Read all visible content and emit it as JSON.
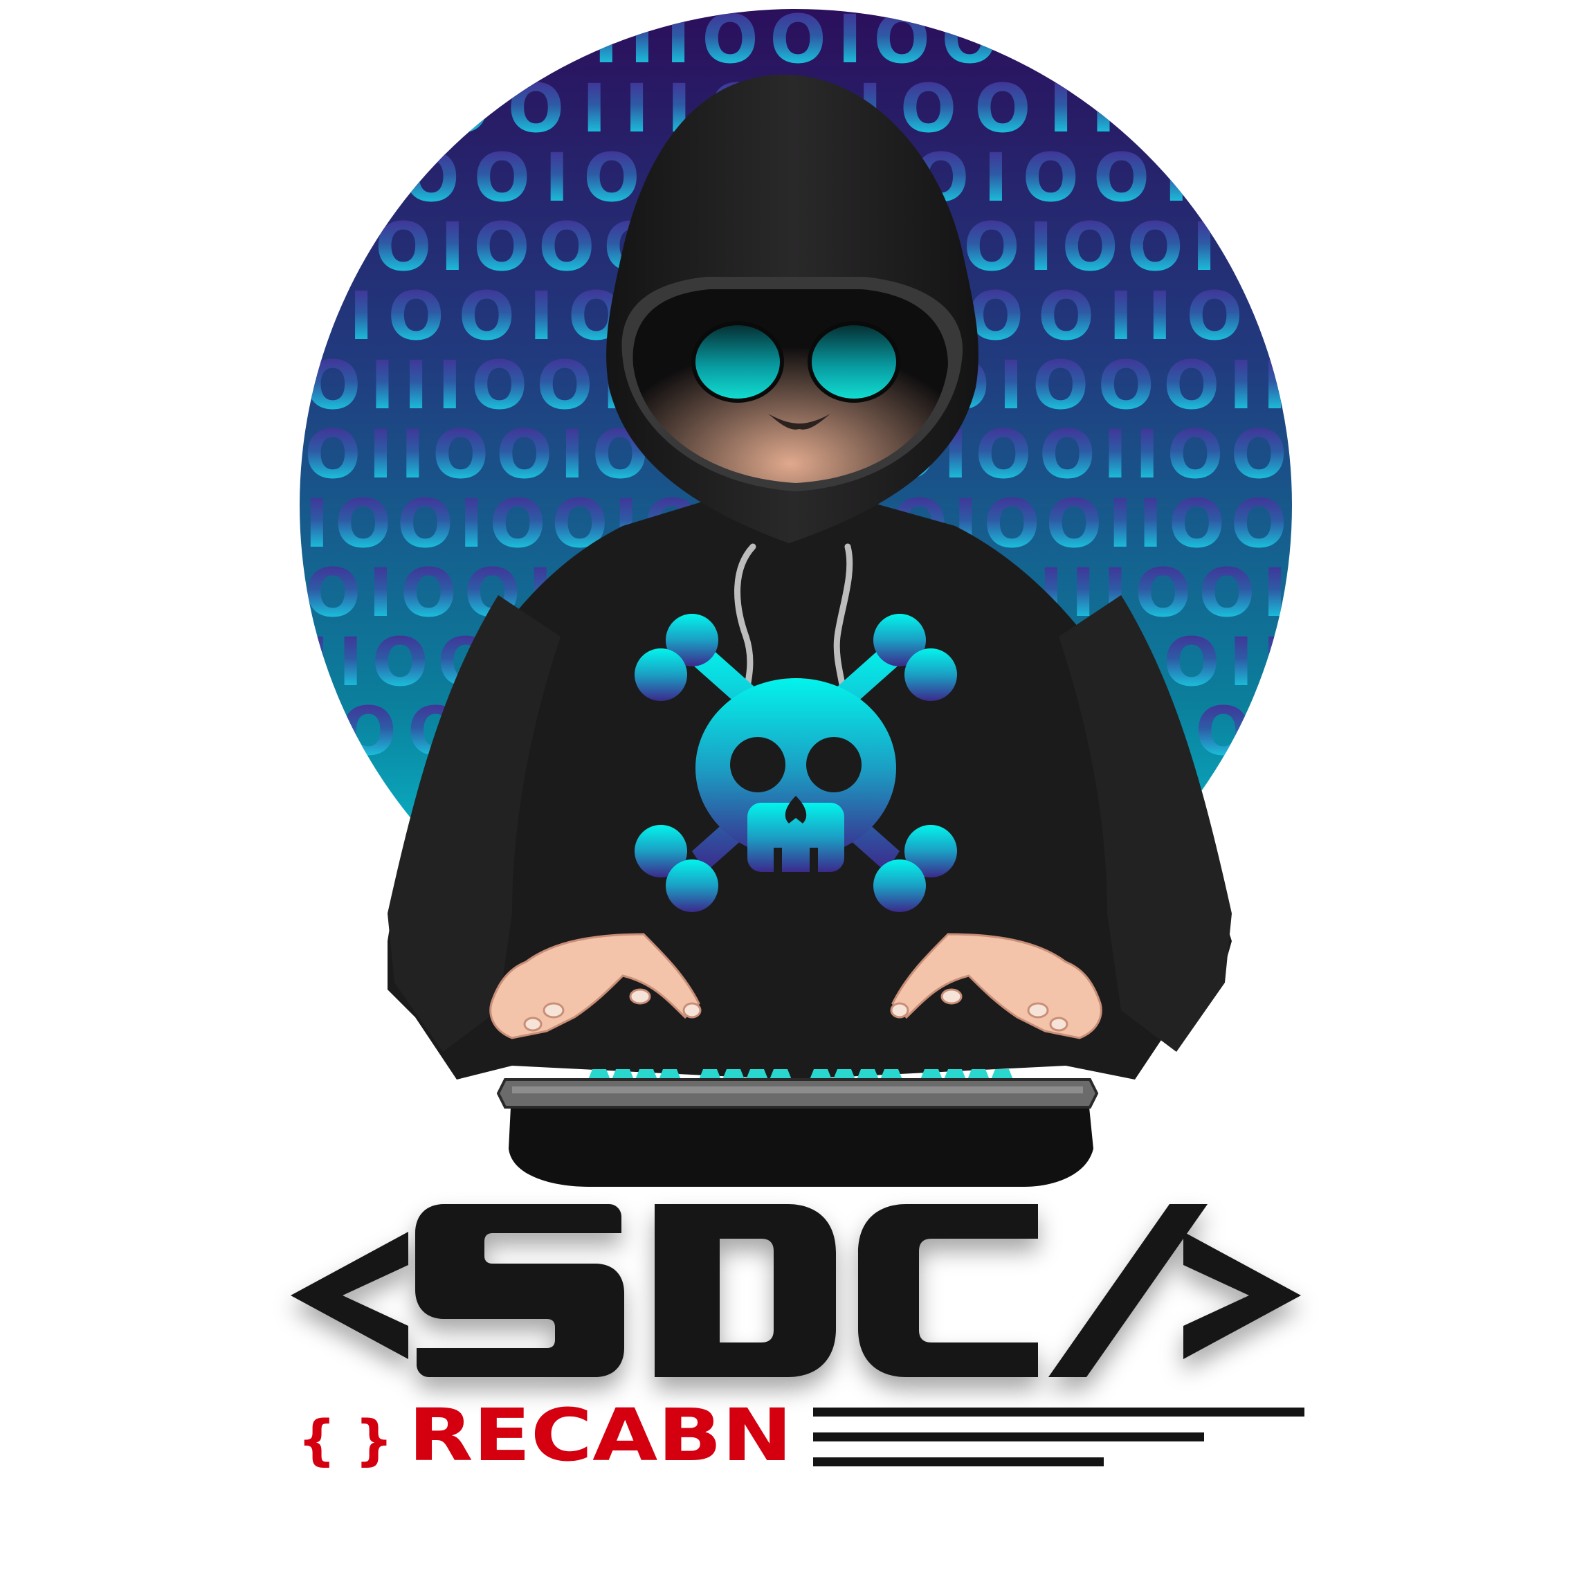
{
  "logo": {
    "wordmark": "<SDC/>",
    "subtitle": "RECABN",
    "brace_glyph": "{ }",
    "binary_rows": [
      "OIIIOOIOOO",
      "IOOIIIOOIOOIIII",
      "IOOIOOIIIOOIOOII",
      "OOIOOOIOOIIOOIOOIO",
      "IIOOIOOIIOOIOOIIOI",
      "OIIIOOIOOIIIOOIOOOII",
      "OIIOOIOOIIIOOIOOIIOO",
      "IOOIOOIOOIIOOIOOIIOO",
      "OIOOIOOIIOOIOOIIIOOI",
      "IIOOIOOIIOOIOOIIOOII",
      "IOOIIOOIOOIIOOIIOOI"
    ],
    "colors": {
      "gradient_top": "#2b0f5c",
      "gradient_bottom": "#07e8f0",
      "hoodie": "#1c1b1c",
      "accent_cyan": "#00f2ec",
      "skin": "#f3c4aa",
      "wordmark": "#131313",
      "subtitle": "#d4000f"
    },
    "icons": [
      "hooded-figure",
      "skull-crossbones-icon",
      "keyboard",
      "curly-braces-icon"
    ]
  }
}
